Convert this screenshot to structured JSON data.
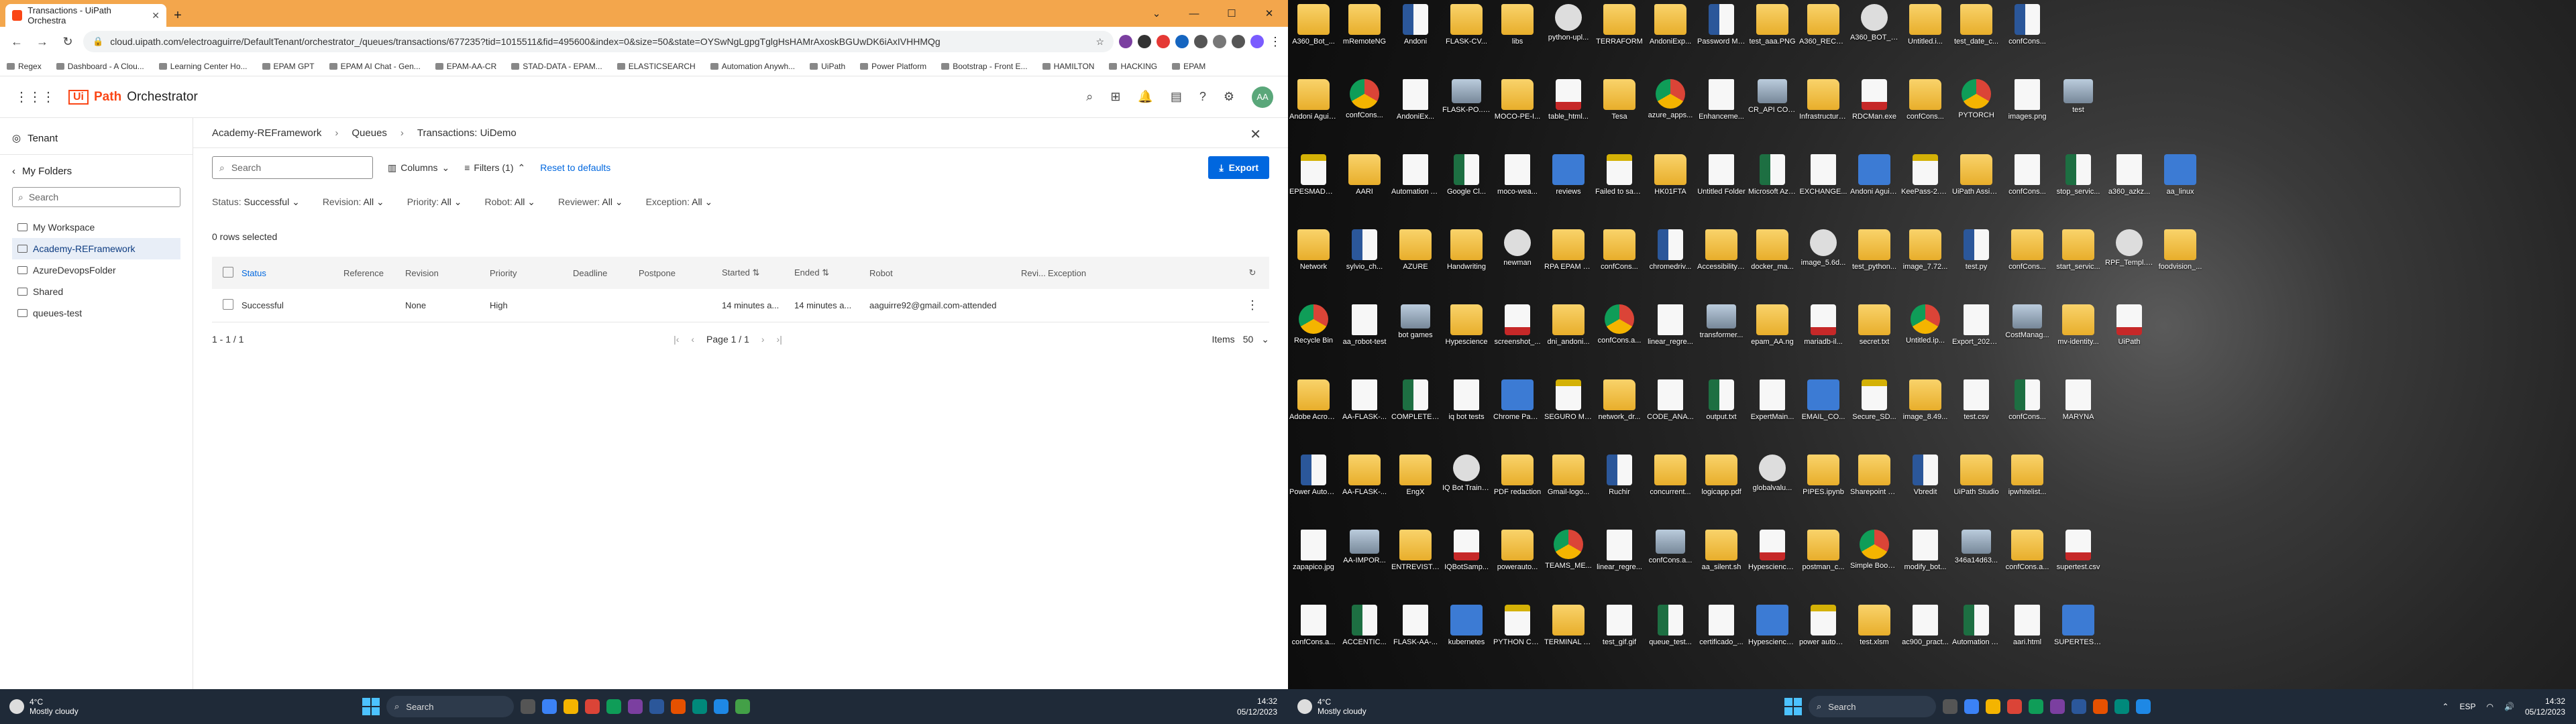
{
  "browser": {
    "tab_title": "Transactions - UiPath Orchestra",
    "url": "cloud.uipath.com/electroaguirre/DefaultTenant/orchestrator_/queues/transactions/677235?tid=1015511&fid=495600&index=0&size=50&state=OYSwNgLgpgTglgHsHAMrAxoskBGUwDK6iAxIVHHMQg",
    "bookmarks": [
      "Regex",
      "Dashboard - A Clou...",
      "Learning Center Ho...",
      "EPAM GPT",
      "EPAM AI Chat - Gen...",
      "EPAM-AA-CR",
      "STAD-DATA - EPAM...",
      "ELASTICSEARCH",
      "Automation Anywh...",
      "UiPath",
      "Power Platform",
      "Bootstrap - Front E...",
      "HAMILTON",
      "HACKING",
      "EPAM"
    ]
  },
  "app": {
    "brand_ui": "Ui",
    "brand_path": "Path",
    "product": "Orchestrator",
    "avatar_initials": "AA"
  },
  "sidebar": {
    "tenant": "Tenant",
    "my_folders": "My Folders",
    "search_placeholder": "Search",
    "items": [
      "My Workspace",
      "Academy-REFramework",
      "AzureDevopsFolder",
      "Shared",
      "queues-test"
    ]
  },
  "breadcrumb": [
    "Academy-REFramework",
    "Queues",
    "Transactions: UiDemo"
  ],
  "toolbar": {
    "search_placeholder": "Search",
    "columns": "Columns",
    "filters": "Filters (1)",
    "reset": "Reset to defaults",
    "export": "Export"
  },
  "filters": [
    {
      "label": "Status:",
      "value": "Successful"
    },
    {
      "label": "Revision:",
      "value": "All"
    },
    {
      "label": "Priority:",
      "value": "All"
    },
    {
      "label": "Robot:",
      "value": "All"
    },
    {
      "label": "Reviewer:",
      "value": "All"
    },
    {
      "label": "Exception:",
      "value": "All"
    }
  ],
  "rows_selected": "0 rows selected",
  "table": {
    "headers": [
      "Status",
      "Reference",
      "Revision",
      "Priority",
      "Deadline",
      "Postpone",
      "Started",
      "Ended",
      "Robot",
      "Revi...",
      "Exception"
    ],
    "rows": [
      [
        "Successful",
        "",
        "None",
        "High",
        "",
        "",
        "14 minutes a...",
        "14 minutes a...",
        "aaguirre92@gmail.com-attended",
        "",
        ""
      ]
    ]
  },
  "pager": {
    "range": "1 - 1 / 1",
    "page": "Page 1 / 1",
    "items_label": "Items",
    "items_value": "50"
  },
  "taskbar": {
    "temp": "4°C",
    "weather": "Mostly cloudy",
    "search": "Search",
    "time": "14:32",
    "date": "05/12/2023",
    "lang": "ESP"
  },
  "desktop": {
    "icons": [
      [
        "A360_Bot_...",
        "mRemoteNG",
        "Andoni",
        "FLASK-CV...",
        "libs",
        "python-upl...",
        "TERRAFORM",
        "AndoniExp...",
        "Password Manag...",
        "test_aaa.PNG",
        "A360_RECO...",
        "A360_BOT_I...",
        "Untitled.i...",
        "test_date_c...",
        "confCons..."
      ],
      [
        "Andoni Aguirre...",
        "confCons...",
        "AndoniEx...",
        "FLASK-PO... CHATBOT",
        "MOCO-PE-I...",
        "table_html...",
        "Tesa",
        "azure_apps...",
        "Enhanceme...",
        "CR_API CONCURRE...",
        "Infrastructure Manageme...",
        "RDCMan.exe",
        "confCons...",
        "PYTORCH",
        "images.png",
        "test"
      ],
      [
        "EPESMADW...",
        "AARI",
        "Automation Anywhere",
        "Google Cl...",
        "moco-wea...",
        "reviews",
        "Failed to save to index du...",
        "HK01FTA",
        "Untitled Folder",
        "Microsoft Azure port...",
        "EXCHANGE...",
        "Andoni Aguirre Av...",
        "KeePass-2.5...",
        "UiPath Assistant",
        "confCons...",
        "stop_servic...",
        "a360_azkz...",
        "aa_linux"
      ],
      [
        "Network",
        "sylvio_ch...",
        "AZURE",
        "Handwriting",
        "newman",
        "RPA EPAM Engi",
        "confCons...",
        "chromedriv...",
        "Accessibility Insights F...",
        "docker_ma...",
        "image_5.6d...",
        "test_python...",
        "image_7.72...",
        "test.py",
        "confCons...",
        "start_servic...",
        "RPF_Templ... (2).docx",
        "foodvision_..."
      ],
      [
        "Recycle Bin",
        "aa_robot-test",
        "bot games",
        "Hypescience",
        "screenshot_...",
        "dni_andoni...",
        "confCons.a...",
        "linear_regre...",
        "transformer...",
        "epam_AA.ng",
        "mariadb-il...",
        "secret.txt",
        "Untitled.ip...",
        "Export_2022... (1)",
        "CostManag...",
        "mv-identity...",
        "UiPath"
      ],
      [
        "Adobe Acrobat",
        "AA-FLASK-...",
        "COMPLETE DATASET",
        "iq bot tests",
        "Chrome Passwords...",
        "SEGURO MEDIC...",
        "network_dr...",
        "CODE_ANA...",
        "output.txt",
        "ExpertMain...",
        "EMAIL_CO...",
        "Secure_SD...",
        "image_8.49...",
        "test.csv",
        "confCons...",
        "MARYNA"
      ],
      [
        "Power Automate",
        "AA-FLASK-...",
        "EngX",
        "IQ Bot Training Files",
        "PDF redaction",
        "Gmail-logo...",
        "Ruchir",
        "concurrent...",
        "logicapp.pdf",
        "globalvalu...",
        "PIPES.ipynb",
        "Sharepoint Excel Con...",
        "Vbredit",
        "UiPath Studio",
        "ipwhitelist..."
      ],
      [
        "zapapico.jpg",
        "AA-IMPOR...",
        "ENTREVISTAS A CANDID...",
        "IQBotSamp...",
        "powerauto...",
        "TEAMS_ME...",
        "linear_regre...",
        "confCons.a...",
        "aa_silent.sh",
        "Hypescience Implement...",
        "postman_c...",
        "Simple Book API - Testin...",
        "modify_bot...",
        "346a14d63...",
        "confCons.a...",
        "supertest.csv"
      ],
      [
        "confCons.a...",
        "ACCENTIC...",
        "FLASK-AA-...",
        "kubernetes",
        "PYTHON COREY ...",
        "TERMINAL EMULATO...",
        "test_gif.gif",
        "queue_test...",
        "certificado_...",
        "Hypescience Implement...",
        "power automa...",
        "test.xlsm",
        "ac900_pract...",
        "Automation Anywhere ...",
        "aari.html",
        "SUPERTEST_..."
      ]
    ]
  },
  "right_taskbar": {
    "temp": "4°C",
    "weather": "Mostly cloudy",
    "search": "Search",
    "time": "14:32",
    "date": "05/12/2023",
    "lang": "ESP"
  }
}
